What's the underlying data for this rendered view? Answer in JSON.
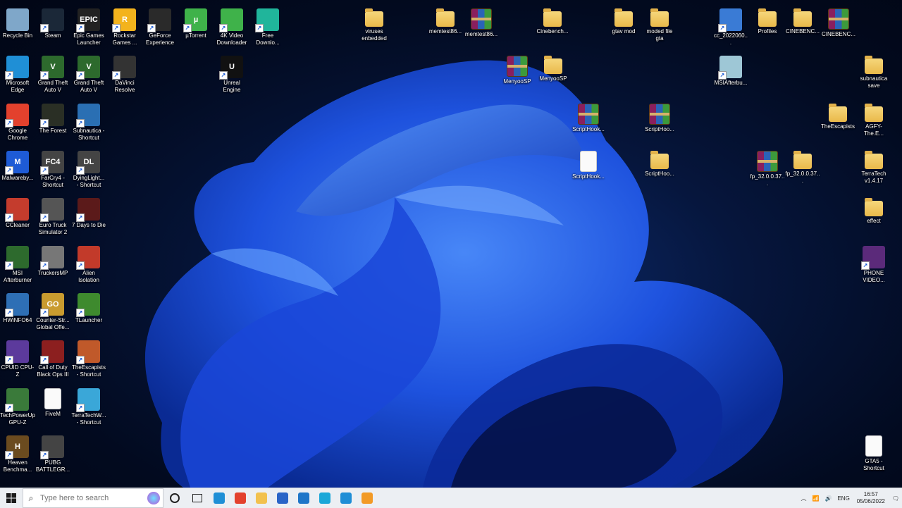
{
  "desktop": {
    "icons": [
      {
        "label": "Recycle Bin",
        "icon": "recycle-bin-icon"
      },
      {
        "label": "Steam",
        "icon": "steam-icon"
      },
      {
        "label": "Epic Games\nLauncher",
        "icon": "epic-games-icon",
        "glyph": "EPIC"
      },
      {
        "label": "Rockstar\nGames ...",
        "icon": "rockstar-icon",
        "glyph": "R"
      },
      {
        "label": "GeForce\nExperience",
        "icon": "nvidia-icon"
      },
      {
        "label": "µTorrent",
        "icon": "utorrent-icon",
        "glyph": "µ"
      },
      {
        "label": "4K Video\nDownloader",
        "icon": "4k-downloader-icon"
      },
      {
        "label": "Free\nDownlo...",
        "icon": "free-download-icon"
      },
      {
        "label": "viruses\nenbedded",
        "icon": "folder-icon"
      },
      {
        "label": "memtest86...",
        "icon": "folder-icon"
      },
      {
        "label": "memtest86...",
        "icon": "rar-archive-icon"
      },
      {
        "label": "Cinebench...",
        "icon": "folder-icon"
      },
      {
        "label": "gtav mod",
        "icon": "folder-icon"
      },
      {
        "label": "moded file\ngta",
        "icon": "folder-icon"
      },
      {
        "label": "cc_2022060...",
        "icon": "ccleaner-file-icon"
      },
      {
        "label": "Profiles",
        "icon": "folder-icon"
      },
      {
        "label": "CINEBENC...",
        "icon": "folder-icon"
      },
      {
        "label": "CINEBENC...",
        "icon": "rar-archive-icon"
      },
      {
        "label": "Microsoft\nEdge",
        "icon": "edge-icon"
      },
      {
        "label": "Grand Theft\nAuto V",
        "icon": "gta-icon",
        "glyph": "V"
      },
      {
        "label": "Grand Theft\nAuto V",
        "icon": "gta-icon",
        "glyph": "V"
      },
      {
        "label": "DaVinci\nResolve",
        "icon": "davinci-icon"
      },
      {
        "label": "Unreal\nEngine",
        "icon": "unreal-icon",
        "glyph": "U"
      },
      {
        "label": "MenyooSP",
        "icon": "rar-archive-icon"
      },
      {
        "label": "MenyooSP",
        "icon": "folder-icon"
      },
      {
        "label": "MSIAfterbu...",
        "icon": "msi-file-icon"
      },
      {
        "label": "subnautica\nsave",
        "icon": "folder-icon"
      },
      {
        "label": "Google\nChrome",
        "icon": "chrome-icon"
      },
      {
        "label": "The Forest",
        "icon": "the-forest-icon"
      },
      {
        "label": "Subnautica -\nShortcut",
        "icon": "subnautica-icon"
      },
      {
        "label": "ScriptHook...",
        "icon": "rar-archive-icon"
      },
      {
        "label": "ScriptHoo...",
        "icon": "rar-archive-icon"
      },
      {
        "label": "TheEscapists",
        "icon": "folder-icon"
      },
      {
        "label": "AGFY-The.E...",
        "icon": "folder-icon"
      },
      {
        "label": "Malwareby...",
        "icon": "malwarebytes-icon",
        "glyph": "M"
      },
      {
        "label": "FarCry4 -\nShortcut",
        "icon": "farcry4-icon",
        "glyph": "FC4"
      },
      {
        "label": "DyingLight...\n- Shortcut",
        "icon": "dyinglight-icon",
        "glyph": "DL"
      },
      {
        "label": "ScriptHook...",
        "icon": "chrome-html-file-icon"
      },
      {
        "label": "ScriptHoo...",
        "icon": "folder-icon"
      },
      {
        "label": "fp_32.0.0.37...",
        "icon": "rar-archive-icon"
      },
      {
        "label": "fp_32.0.0.37...",
        "icon": "folder-icon"
      },
      {
        "label": "TerraTech\nv1.4.17",
        "icon": "folder-icon"
      },
      {
        "label": "CCleaner",
        "icon": "ccleaner-icon"
      },
      {
        "label": "Euro Truck\nSimulator 2",
        "icon": "euro-truck-icon"
      },
      {
        "label": "7 Days to Die",
        "icon": "7days-icon"
      },
      {
        "label": "effect",
        "icon": "folder-icon"
      },
      {
        "label": "MSI\nAfterburner",
        "icon": "msi-afterburner-icon"
      },
      {
        "label": "TruckersMP",
        "icon": "truckersmp-icon"
      },
      {
        "label": "Alien\nIsolation",
        "icon": "alien-isolation-icon"
      },
      {
        "label": "PHONE\nVIDEO...",
        "icon": "video-file-icon"
      },
      {
        "label": "HWiNFO64",
        "icon": "hwinfo-icon"
      },
      {
        "label": "Counter-Str...\nGlobal Offe...",
        "icon": "csgo-icon",
        "glyph": "GO"
      },
      {
        "label": "TLauncher",
        "icon": "tlauncher-icon"
      },
      {
        "label": "CPUID CPU-Z",
        "icon": "cpuz-icon"
      },
      {
        "label": "Call of Duty\nBlack Ops III",
        "icon": "cod-bo3-icon"
      },
      {
        "label": "TheEscapists\n- Shortcut",
        "icon": "escapists-icon"
      },
      {
        "label": "TechPowerUp\nGPU-Z",
        "icon": "gpuz-icon"
      },
      {
        "label": "FiveM",
        "icon": "blank-file-icon"
      },
      {
        "label": "TerraTechW...\n- Shortcut",
        "icon": "terratech-icon"
      },
      {
        "label": "Heaven\nBenchma...",
        "icon": "heaven-icon",
        "glyph": "H"
      },
      {
        "label": "PUBG\nBATTLEGR...",
        "icon": "pubg-icon"
      },
      {
        "label": "GTA5 -\nShortcut",
        "icon": "blank-file-icon"
      }
    ]
  },
  "taskbar": {
    "search_placeholder": "Type here to search",
    "pinned": [
      {
        "name": "edge",
        "color": "#1f8fd6"
      },
      {
        "name": "chrome",
        "color": "#e3412d"
      },
      {
        "name": "file-explorer",
        "color": "#f2c14e"
      },
      {
        "name": "store",
        "color": "#2a64c7"
      },
      {
        "name": "mail",
        "color": "#1f76c8"
      },
      {
        "name": "app-l",
        "color": "#1aa7d8"
      },
      {
        "name": "app-blue",
        "color": "#1f8ed6"
      },
      {
        "name": "app-orange",
        "color": "#f29a26"
      }
    ],
    "tray": {
      "language": "ENG",
      "time": "16:57",
      "date": "05/06/2022"
    }
  }
}
